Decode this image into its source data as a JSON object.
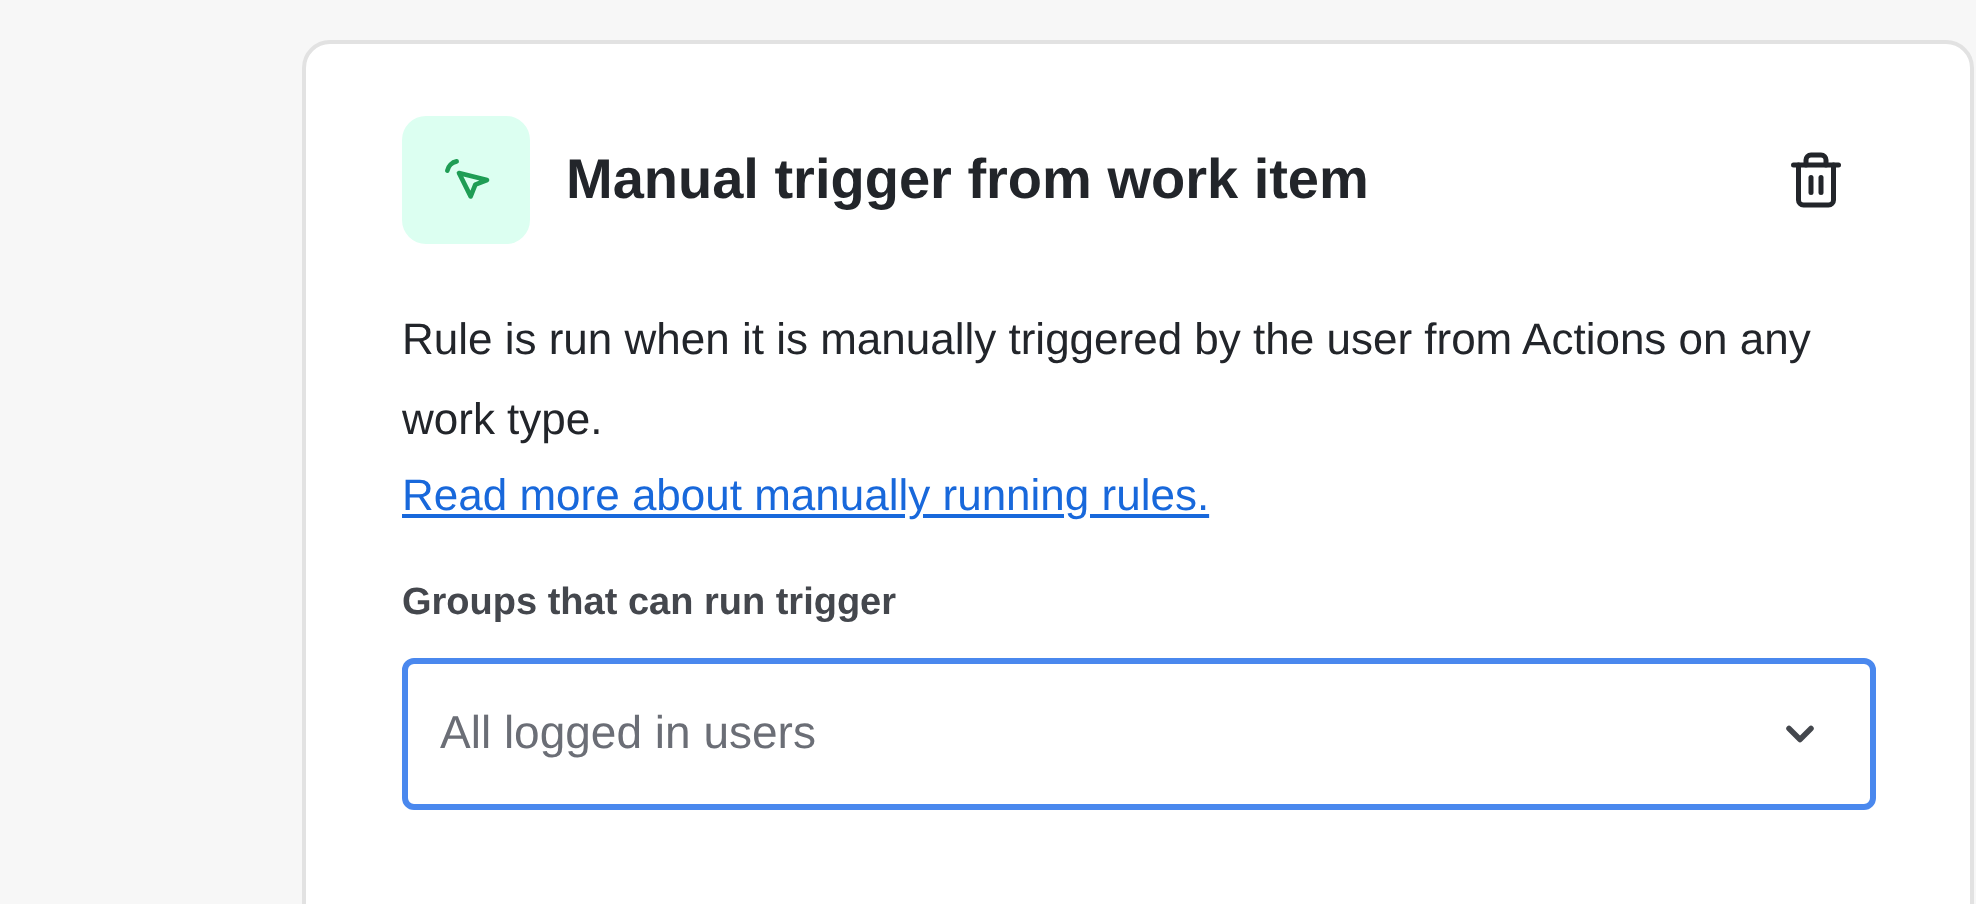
{
  "card": {
    "title": "Manual trigger from work item",
    "description": "Rule is run when it is manually triggered by the user from Actions on any work type.",
    "link": "Read more about manually running rules.",
    "field": {
      "label": "Groups that can run trigger",
      "placeholder": "All logged in users"
    }
  }
}
